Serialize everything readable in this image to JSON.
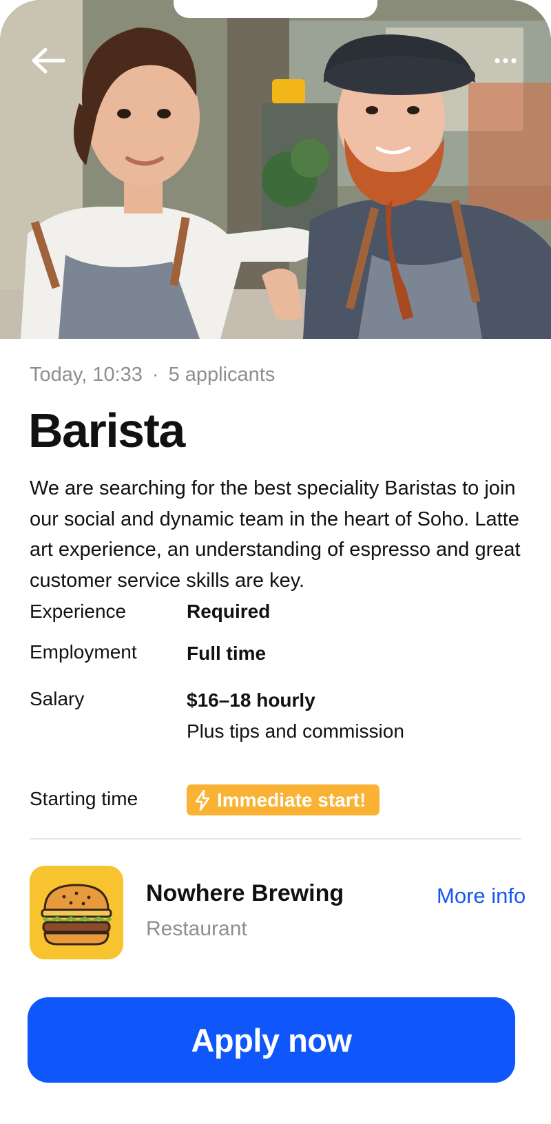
{
  "job": {
    "posted_time": "Today, 10:33",
    "separator": "·",
    "applicants": "5 applicants",
    "title": "Barista",
    "description": "We are searching for the best speciality Baristas to join our social and dynamic team in the heart of Soho. Latte art experience, an understanding of espresso and great customer service skills are key."
  },
  "details": {
    "experience_label": "Experience",
    "experience_value": "Required",
    "employment_label": "Employment",
    "employment_value": "Full time",
    "salary_label": "Salary",
    "salary_value": "$16–18 hourly",
    "salary_note": "Plus tips and commission",
    "starting_label": "Starting time",
    "starting_badge": "Immediate start!"
  },
  "company": {
    "name": "Nowhere Brewing",
    "type": "Restaurant",
    "more_info": "More info",
    "logo_icon": "burger-icon"
  },
  "actions": {
    "apply": "Apply now"
  },
  "icons": {
    "back": "arrow-left-icon",
    "more": "ellipsis-icon",
    "bolt": "lightning-bolt-icon"
  },
  "colors": {
    "accent": "#0f57fb",
    "link": "#1556f2",
    "badge": "#f9b233",
    "logo_bg": "#f7c42f",
    "muted_text": "#8d8d92"
  }
}
